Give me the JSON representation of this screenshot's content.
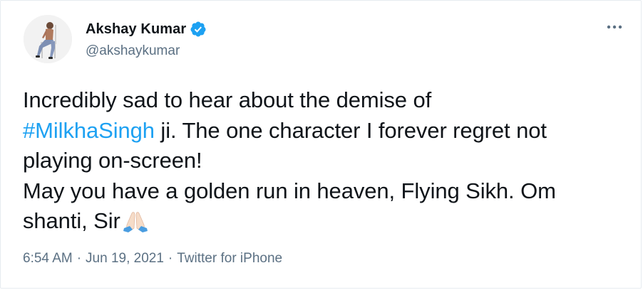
{
  "author": {
    "display_name": "Akshay Kumar",
    "handle": "@akshaykumar",
    "verified": true,
    "verified_icon": "verified-badge-icon",
    "verified_color": "#1da1f2"
  },
  "menu": {
    "icon": "more-options-icon"
  },
  "tweet": {
    "line1": "Incredibly sad to hear about the demise of",
    "hashtag": "#MilkhaSingh",
    "line2_rest": " ji. The one character I forever regret not",
    "line3": "playing on-screen!",
    "line4": "May you have a golden run in heaven, Flying Sikh. Om",
    "line5": "shanti, Sir",
    "emoji": "folded-hands-emoji",
    "hashtag_color": "#1da1f2"
  },
  "meta": {
    "time": "6:54 AM",
    "separator": "·",
    "date": "Jun 19, 2021",
    "source": "Twitter for iPhone"
  }
}
